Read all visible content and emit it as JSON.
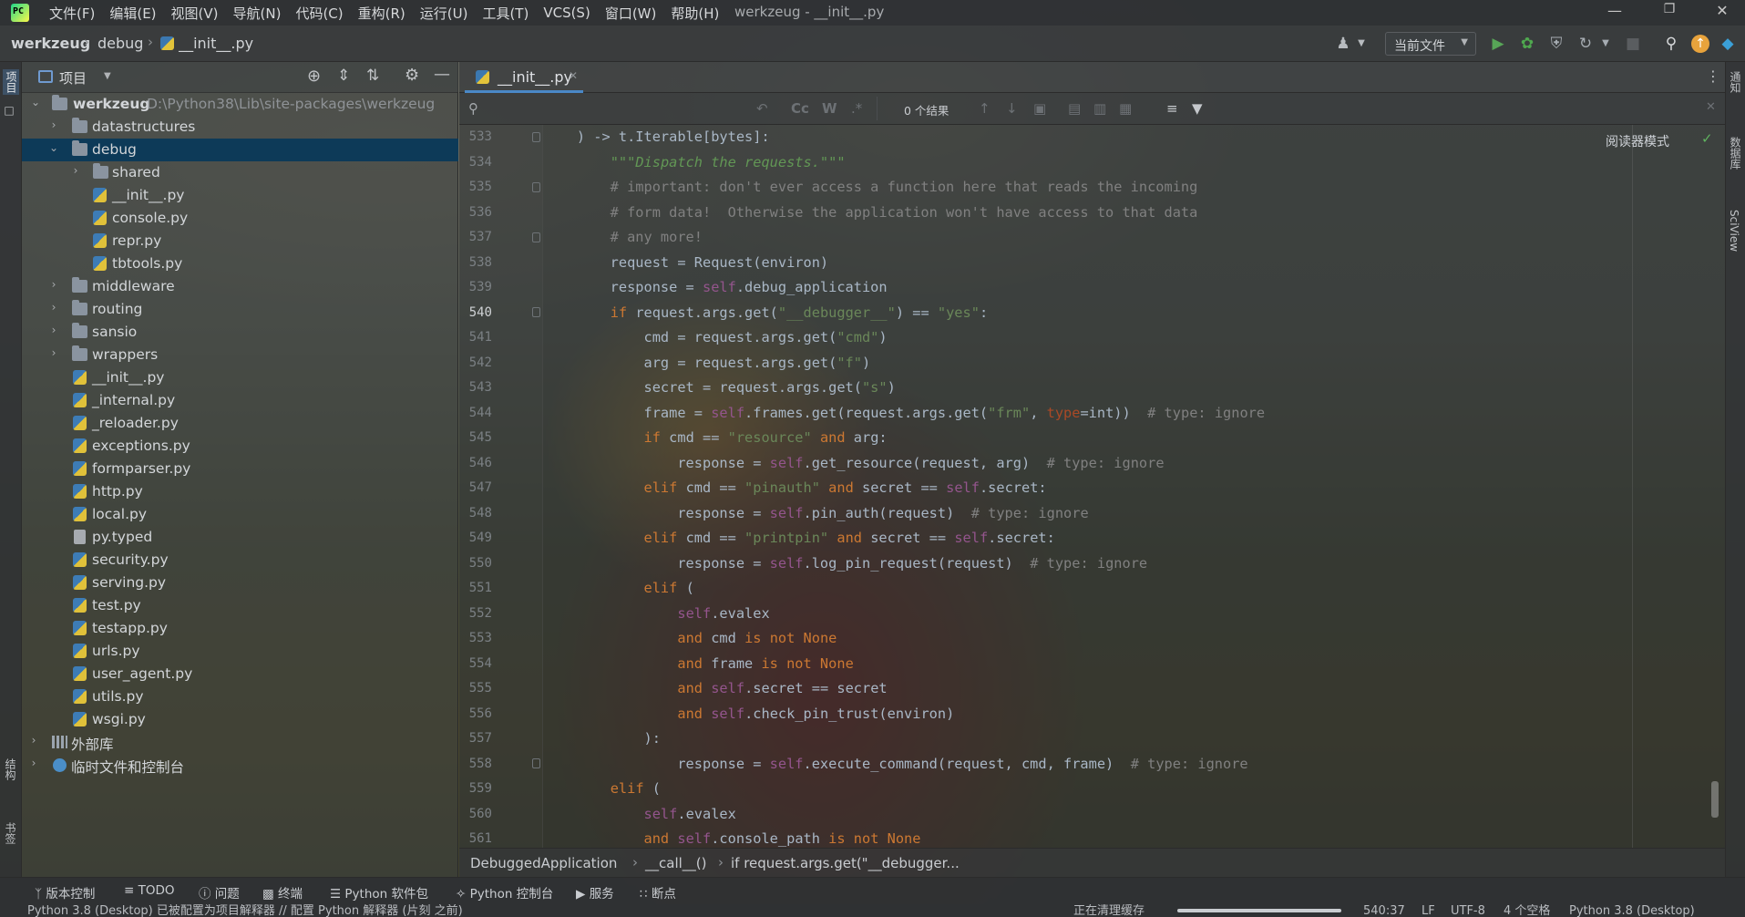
{
  "menubar": {
    "items": [
      "文件(F)",
      "编辑(E)",
      "视图(V)",
      "导航(N)",
      "代码(C)",
      "重构(R)",
      "运行(U)",
      "工具(T)",
      "VCS(S)",
      "窗口(W)",
      "帮助(H)"
    ],
    "window_title": "werkzeug - __init__.py"
  },
  "navbar": {
    "crumbs": [
      "werkzeug",
      "debug",
      "__init__.py"
    ],
    "run_config": "当前文件"
  },
  "left_strip": {
    "project_label": "项目",
    "structure_label": "结构",
    "bookmarks_label": "书签"
  },
  "right_strip": {
    "notifications_label": "通知",
    "database_label": "数据库",
    "sciview_label": "SciView"
  },
  "project": {
    "title": "项目",
    "tree": [
      {
        "label": "werkzeug",
        "path": "D:\\Python38\\Lib\\site-packages\\werkzeug"
      },
      {
        "label": "datastructures"
      },
      {
        "label": "debug"
      },
      {
        "label": "shared"
      },
      {
        "label": "__init__.py"
      },
      {
        "label": "console.py"
      },
      {
        "label": "repr.py"
      },
      {
        "label": "tbtools.py"
      },
      {
        "label": "middleware"
      },
      {
        "label": "routing"
      },
      {
        "label": "sansio"
      },
      {
        "label": "wrappers"
      },
      {
        "label": "__init__.py"
      },
      {
        "label": "_internal.py"
      },
      {
        "label": "_reloader.py"
      },
      {
        "label": "exceptions.py"
      },
      {
        "label": "formparser.py"
      },
      {
        "label": "http.py"
      },
      {
        "label": "local.py"
      },
      {
        "label": "py.typed"
      },
      {
        "label": "security.py"
      },
      {
        "label": "serving.py"
      },
      {
        "label": "test.py"
      },
      {
        "label": "testapp.py"
      },
      {
        "label": "urls.py"
      },
      {
        "label": "user_agent.py"
      },
      {
        "label": "utils.py"
      },
      {
        "label": "wsgi.py"
      },
      {
        "label": "外部库"
      },
      {
        "label": "临时文件和控制台"
      }
    ]
  },
  "editor": {
    "tab_label": "__init__.py",
    "search_result": "0 个结果",
    "search_opts": [
      "Cc",
      "W",
      ".*"
    ],
    "reader_mode": "阅读器模式",
    "line_numbers": [
      "533",
      "534",
      "535",
      "536",
      "537",
      "538",
      "539",
      "540",
      "541",
      "542",
      "543",
      "544",
      "545",
      "546",
      "547",
      "548",
      "549",
      "550",
      "551",
      "552",
      "553",
      "554",
      "555",
      "556",
      "557",
      "558",
      "559",
      "560",
      "561"
    ]
  },
  "code_crumbs": [
    "DebuggedApplication",
    "__call__()",
    "if request.args.get(\"__debugger..."
  ],
  "bottom_tools": [
    "版本控制",
    "TODO",
    "问题",
    "终端",
    "Python 软件包",
    "Python 控制台",
    "服务",
    "断点"
  ],
  "status": {
    "message": "Python 3.8 (Desktop) 已被配置为项目解释器 // 配置 Python 解释器 (片刻 之前)",
    "task": "正在清理缓存",
    "position": "540:37",
    "line_sep": "LF",
    "encoding": "UTF-8",
    "indent": "4 个空格",
    "interpreter": "Python 3.8 (Desktop)"
  },
  "colors": {
    "keyword": "#cc7832",
    "string": "#6a8759",
    "comment": "#808080",
    "self": "#94558d",
    "selection": "#0d3a58",
    "accent": "#4a88c7"
  }
}
